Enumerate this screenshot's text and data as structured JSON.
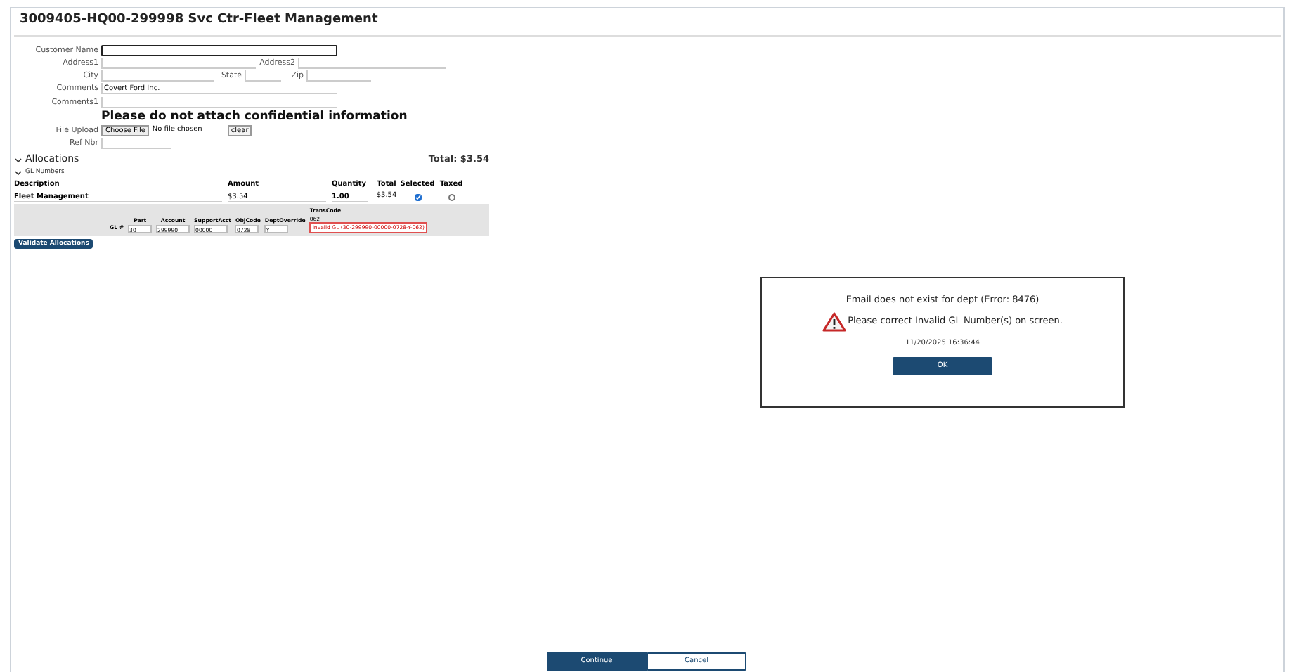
{
  "title": "3009405-HQ00-299998 Svc Ctr-Fleet Management",
  "form": {
    "customer_name": {
      "label": "Customer Name"
    },
    "address1": {
      "label": "Address1"
    },
    "address2": {
      "label": "Address2"
    },
    "city": {
      "label": "City"
    },
    "state": {
      "label": "State"
    },
    "zip": {
      "label": "Zip"
    },
    "comments": {
      "label": "Comments",
      "value": "Covert Ford Inc."
    },
    "comments1": {
      "label": "Comments1"
    },
    "notice": "Please do not attach confidential information",
    "file_upload": {
      "label": "File Upload",
      "button": "Choose File",
      "status": "No file chosen",
      "clear": "clear"
    },
    "ref_nbr": {
      "label": "Ref Nbr"
    }
  },
  "allocations": {
    "title": "Allocations",
    "expanded": true,
    "total": "Total: $3.54",
    "gl_title": "GL Numbers",
    "gl_expanded": true,
    "columns": [
      "Description",
      "Amount",
      "Quantity",
      "Total",
      "Selected",
      "Taxed"
    ],
    "rows": [
      {
        "description": "Fleet Management",
        "amount": "$3.54",
        "quantity": "1.00",
        "total": "$3.54",
        "selected": true,
        "taxed": false
      }
    ],
    "gl": {
      "label": "GL #",
      "fields": [
        {
          "label": "Part",
          "value": "30"
        },
        {
          "label": "Account",
          "value": "299990"
        },
        {
          "label": "SupportAcct",
          "value": "00000"
        },
        {
          "label": "ObjCode",
          "value": "0728"
        },
        {
          "label": "DeptOverride",
          "value": "Y"
        }
      ],
      "trans_label": "TransCode",
      "trans_value": "062",
      "error": "Invalid GL (30-299990-00000-0728-Y-062)"
    },
    "validate_button": "Validate Allocations"
  },
  "dialog": {
    "message": "Email does not exist for dept (Error: 8476)",
    "warning": "Please correct Invalid GL Number(s) on screen.",
    "timestamp": "11/20/2025 16:36:44",
    "ok": "OK"
  },
  "footer": {
    "continue": "Continue",
    "cancel": "Cancel"
  }
}
